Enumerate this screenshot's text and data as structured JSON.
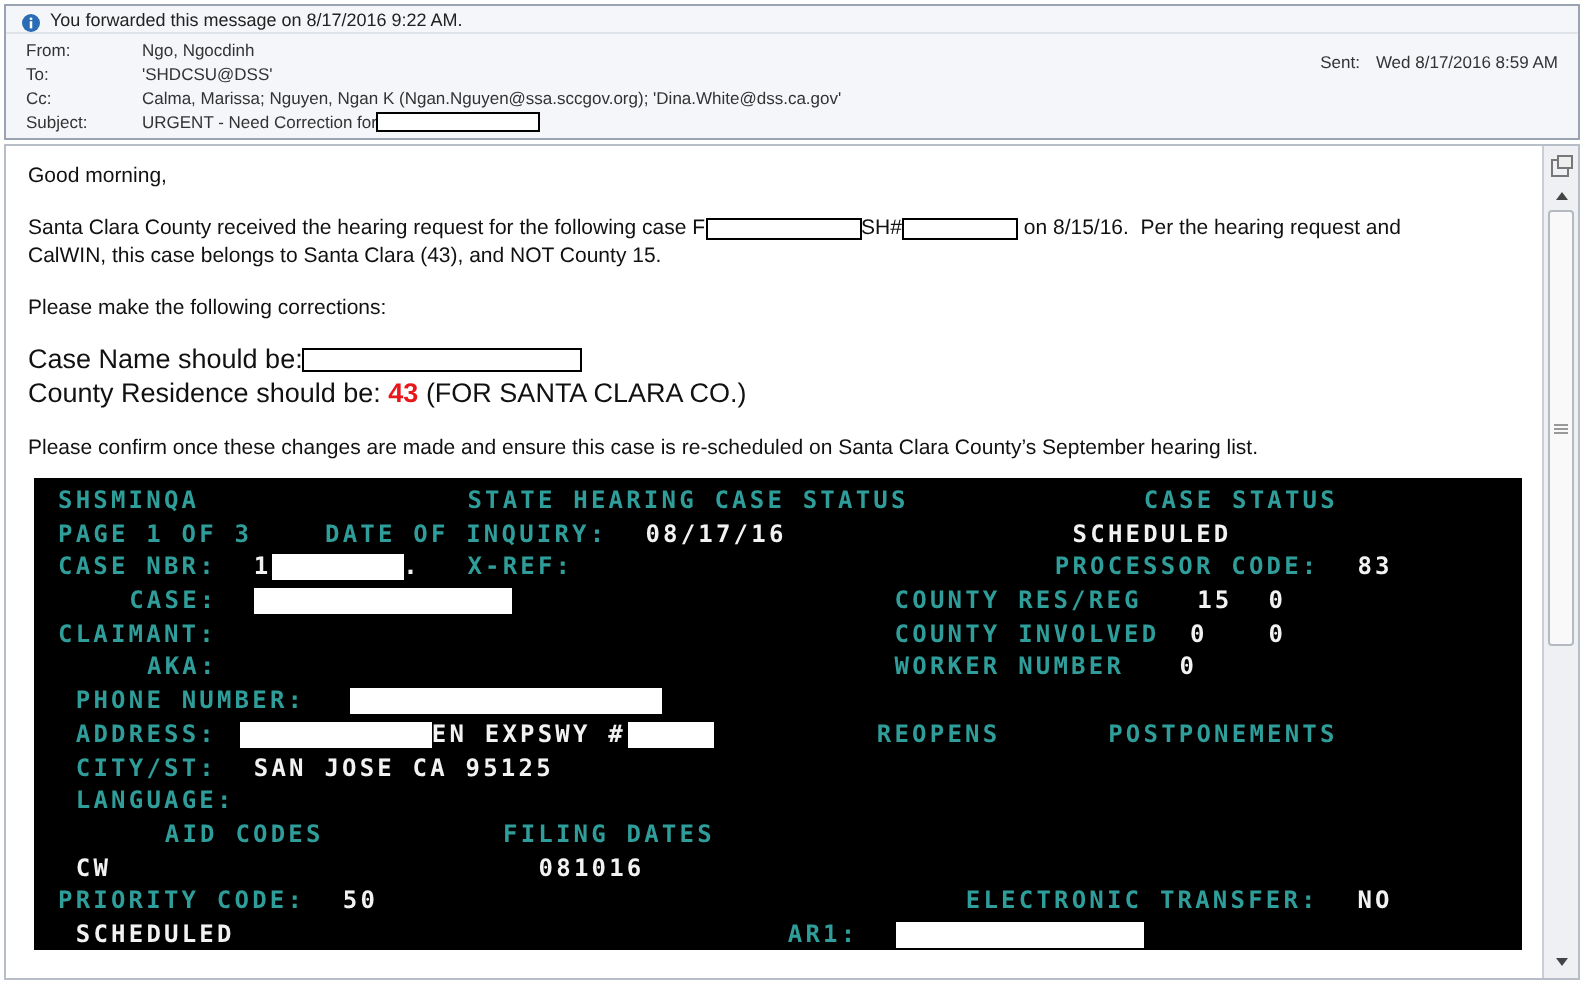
{
  "info_bar": {
    "text": "You forwarded this message on 8/17/2016 9:22 AM."
  },
  "header": {
    "fields": [
      {
        "label": "From:",
        "value": "Ngo, Ngocdinh"
      },
      {
        "label": "To:",
        "value": "'SHDCSU@DSS'"
      },
      {
        "label": "Cc:",
        "value": "Calma, Marissa; Nguyen, Ngan K (Ngan.Nguyen@ssa.sccgov.org); 'Dina.White@dss.ca.gov'"
      },
      {
        "label": "Subject:",
        "value": "URGENT - Need Correction for",
        "redacted": true
      }
    ],
    "sent": {
      "label": "Sent:",
      "value": "Wed 8/17/2016 8:59 AM"
    }
  },
  "body": {
    "greeting": "Good morning,",
    "paragraph": [
      [
        {
          "kind": "text",
          "text": "Santa Clara County received the hearing request for the following case F"
        },
        {
          "kind": "redaction"
        },
        {
          "kind": "text",
          "text": "SH#"
        },
        {
          "kind": "redaction"
        },
        {
          "kind": "text",
          "text": " on 8/15/16.  Per the hearing request and"
        }
      ],
      [
        {
          "kind": "text",
          "text": "CalWIN, this case belongs to Santa Clara (43), and NOT County 15."
        }
      ]
    ],
    "request": "Please make the following corrections:",
    "case_name": {
      "label": "Case Name should be:",
      "redacted": true
    },
    "county": {
      "label": "County Residence should be:",
      "value": "43",
      "note": "(FOR SANTA CLARA CO.)"
    },
    "closing": "Please confirm once these changes are made and ensure this case is re-scheduled on Santa Clara County’s September hearing list."
  },
  "terminal": {
    "lines": [
      [
        {
          "kind": "label",
          "text": "SHSMINQA"
        },
        {
          "kind": "label",
          "text": "STATE HEARING CASE STATUS"
        },
        {
          "kind": "label",
          "text": "CASE STATUS"
        }
      ],
      [
        {
          "kind": "label",
          "text": "PAGE 1 OF 3"
        },
        {
          "kind": "label",
          "text": "DATE OF INQUIRY:"
        },
        {
          "kind": "value",
          "text": "08/17/16"
        },
        {
          "kind": "value",
          "text": "SCHEDULED"
        }
      ],
      [
        {
          "kind": "label",
          "text": "CASE NBR:"
        },
        {
          "kind": "value",
          "text": "1"
        },
        {
          "kind": "redaction"
        },
        {
          "kind": "value",
          "text": "."
        },
        {
          "kind": "label",
          "text": "X-REF:"
        },
        {
          "kind": "label",
          "text": "PROCESSOR CODE:"
        },
        {
          "kind": "value",
          "text": "83"
        }
      ],
      [
        {
          "kind": "label",
          "text": "CASE:"
        },
        {
          "kind": "redaction"
        },
        {
          "kind": "label",
          "text": "COUNTY RES/REG"
        },
        {
          "kind": "value",
          "text": "15"
        },
        {
          "kind": "value",
          "text": "0"
        }
      ],
      [
        {
          "kind": "label",
          "text": "CLAIMANT:"
        },
        {
          "kind": "label",
          "text": "COUNTY INVOLVED"
        },
        {
          "kind": "value",
          "text": "0"
        },
        {
          "kind": "value",
          "text": "0"
        }
      ],
      [
        {
          "kind": "label",
          "text": "AKA:"
        },
        {
          "kind": "label",
          "text": "WORKER NUMBER"
        },
        {
          "kind": "value",
          "text": "0"
        }
      ],
      [
        {
          "kind": "label",
          "text": "PHONE NUMBER:"
        },
        {
          "kind": "redaction"
        }
      ],
      [
        {
          "kind": "label",
          "text": "ADDRESS:"
        },
        {
          "kind": "redaction"
        },
        {
          "kind": "value",
          "text": "EN EXPSWY #"
        },
        {
          "kind": "redaction"
        },
        {
          "kind": "label",
          "text": "REOPENS"
        },
        {
          "kind": "label",
          "text": "POSTPONEMENTS"
        }
      ],
      [
        {
          "kind": "label",
          "text": "CITY/ST:"
        },
        {
          "kind": "value",
          "text": "SAN JOSE CA 95125"
        }
      ],
      [
        {
          "kind": "label",
          "text": "LANGUAGE:"
        }
      ],
      [
        {
          "kind": "label",
          "text": "AID CODES"
        },
        {
          "kind": "label",
          "text": "FILING DATES"
        }
      ],
      [
        {
          "kind": "value",
          "text": "CW"
        },
        {
          "kind": "value",
          "text": "081016"
        }
      ],
      [
        {
          "kind": "label",
          "text": "PRIORITY CODE:"
        },
        {
          "kind": "value",
          "text": "50"
        },
        {
          "kind": "label",
          "text": "ELECTRONIC TRANSFER:"
        },
        {
          "kind": "value",
          "text": "NO"
        }
      ],
      [
        {
          "kind": "value",
          "text": "SCHEDULED"
        },
        {
          "kind": "label",
          "text": "AR1:"
        },
        {
          "kind": "redaction"
        }
      ]
    ]
  }
}
